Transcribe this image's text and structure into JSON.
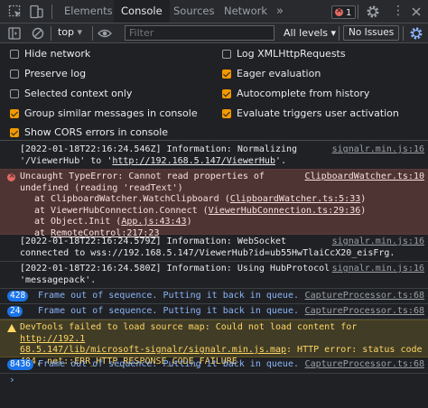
{
  "devtools": {
    "tabs": [
      "Elements",
      "Console",
      "Sources",
      "Network"
    ],
    "more_tabs": "»",
    "error_count": "1",
    "menu": "⋮"
  },
  "toolbar": {
    "context": "top",
    "filter_placeholder": "Filter",
    "levels": "All levels ▾",
    "issues": "No Issues"
  },
  "settings": {
    "left": [
      {
        "label": "Hide network",
        "checked": false
      },
      {
        "label": "Preserve log",
        "checked": false
      },
      {
        "label": "Selected context only",
        "checked": false
      },
      {
        "label": "Group similar messages in console",
        "checked": true
      },
      {
        "label": "Show CORS errors in console",
        "checked": true
      }
    ],
    "right": [
      {
        "label": "Log XMLHttpRequests",
        "checked": false
      },
      {
        "label": "Eager evaluation",
        "checked": true
      },
      {
        "label": "Autocomplete from history",
        "checked": true
      },
      {
        "label": "Evaluate triggers user activation",
        "checked": true
      }
    ]
  },
  "console": {
    "m1": {
      "l1": "[2022-01-18T22:16:24.546Z] Information: Normalizing",
      "l2a": "'/ViewerHub' to '",
      "l2link": "http://192.168.5.147/ViewerHub",
      "l2b": "'.",
      "src": "signalr.min.js:16"
    },
    "m2": {
      "l1": "Uncaught TypeError: Cannot read properties of",
      "l2": "undefined (reading 'readText')",
      "src": "ClipboardWatcher.ts:10",
      "s1a": "at ClipboardWatcher.WatchClipboard (",
      "s1l": "ClipboardWatcher.ts:5:33",
      "s1b": ")",
      "s2a": "at ViewerHubConnection.Connect (",
      "s2l": "ViewerHubConnection.ts:29:36",
      "s2b": ")",
      "s3a": "at Object.Init (",
      "s3l": "App.js:43:43",
      "s3b": ")",
      "s4a": "at ",
      "s4l": "RemoteControl:217:23"
    },
    "m3": {
      "l1": "[2022-01-18T22:16:24.579Z] Information: WebSocket",
      "l2": "connected to wss://192.168.5.147/ViewerHub?id=ub55HwTlaiCcX20_eisFrg.",
      "src": "signalr.min.js:16"
    },
    "m4": {
      "l1": "[2022-01-18T22:16:24.580Z] Information: Using HubProtocol",
      "l2": "'messagepack'.",
      "src": "signalr.min.js:16"
    },
    "m5": {
      "count": "428",
      "text": "Frame out of sequence.  Putting it back in queue.",
      "src": "CaptureProcessor.ts:68"
    },
    "m6": {
      "count": "24",
      "text": "Frame out of sequence.  Putting it back in queue.",
      "src": "CaptureProcessor.ts:68"
    },
    "m7": {
      "l1a": "DevTools failed to load source map: Could not load content for ",
      "l1link": "http://192.1",
      "l2link": "68.5.147/lib/microsoft-signalr/signalr.min.js.map",
      "l2b": ": HTTP error: status code",
      "l3": "404, net::ERR_HTTP_RESPONSE_CODE_FAILURE"
    },
    "m8": {
      "count": "8436",
      "text": "Frame out of sequence.  Putting it back in queue.",
      "src": "CaptureProcessor.ts:68"
    },
    "prompt": "›"
  }
}
